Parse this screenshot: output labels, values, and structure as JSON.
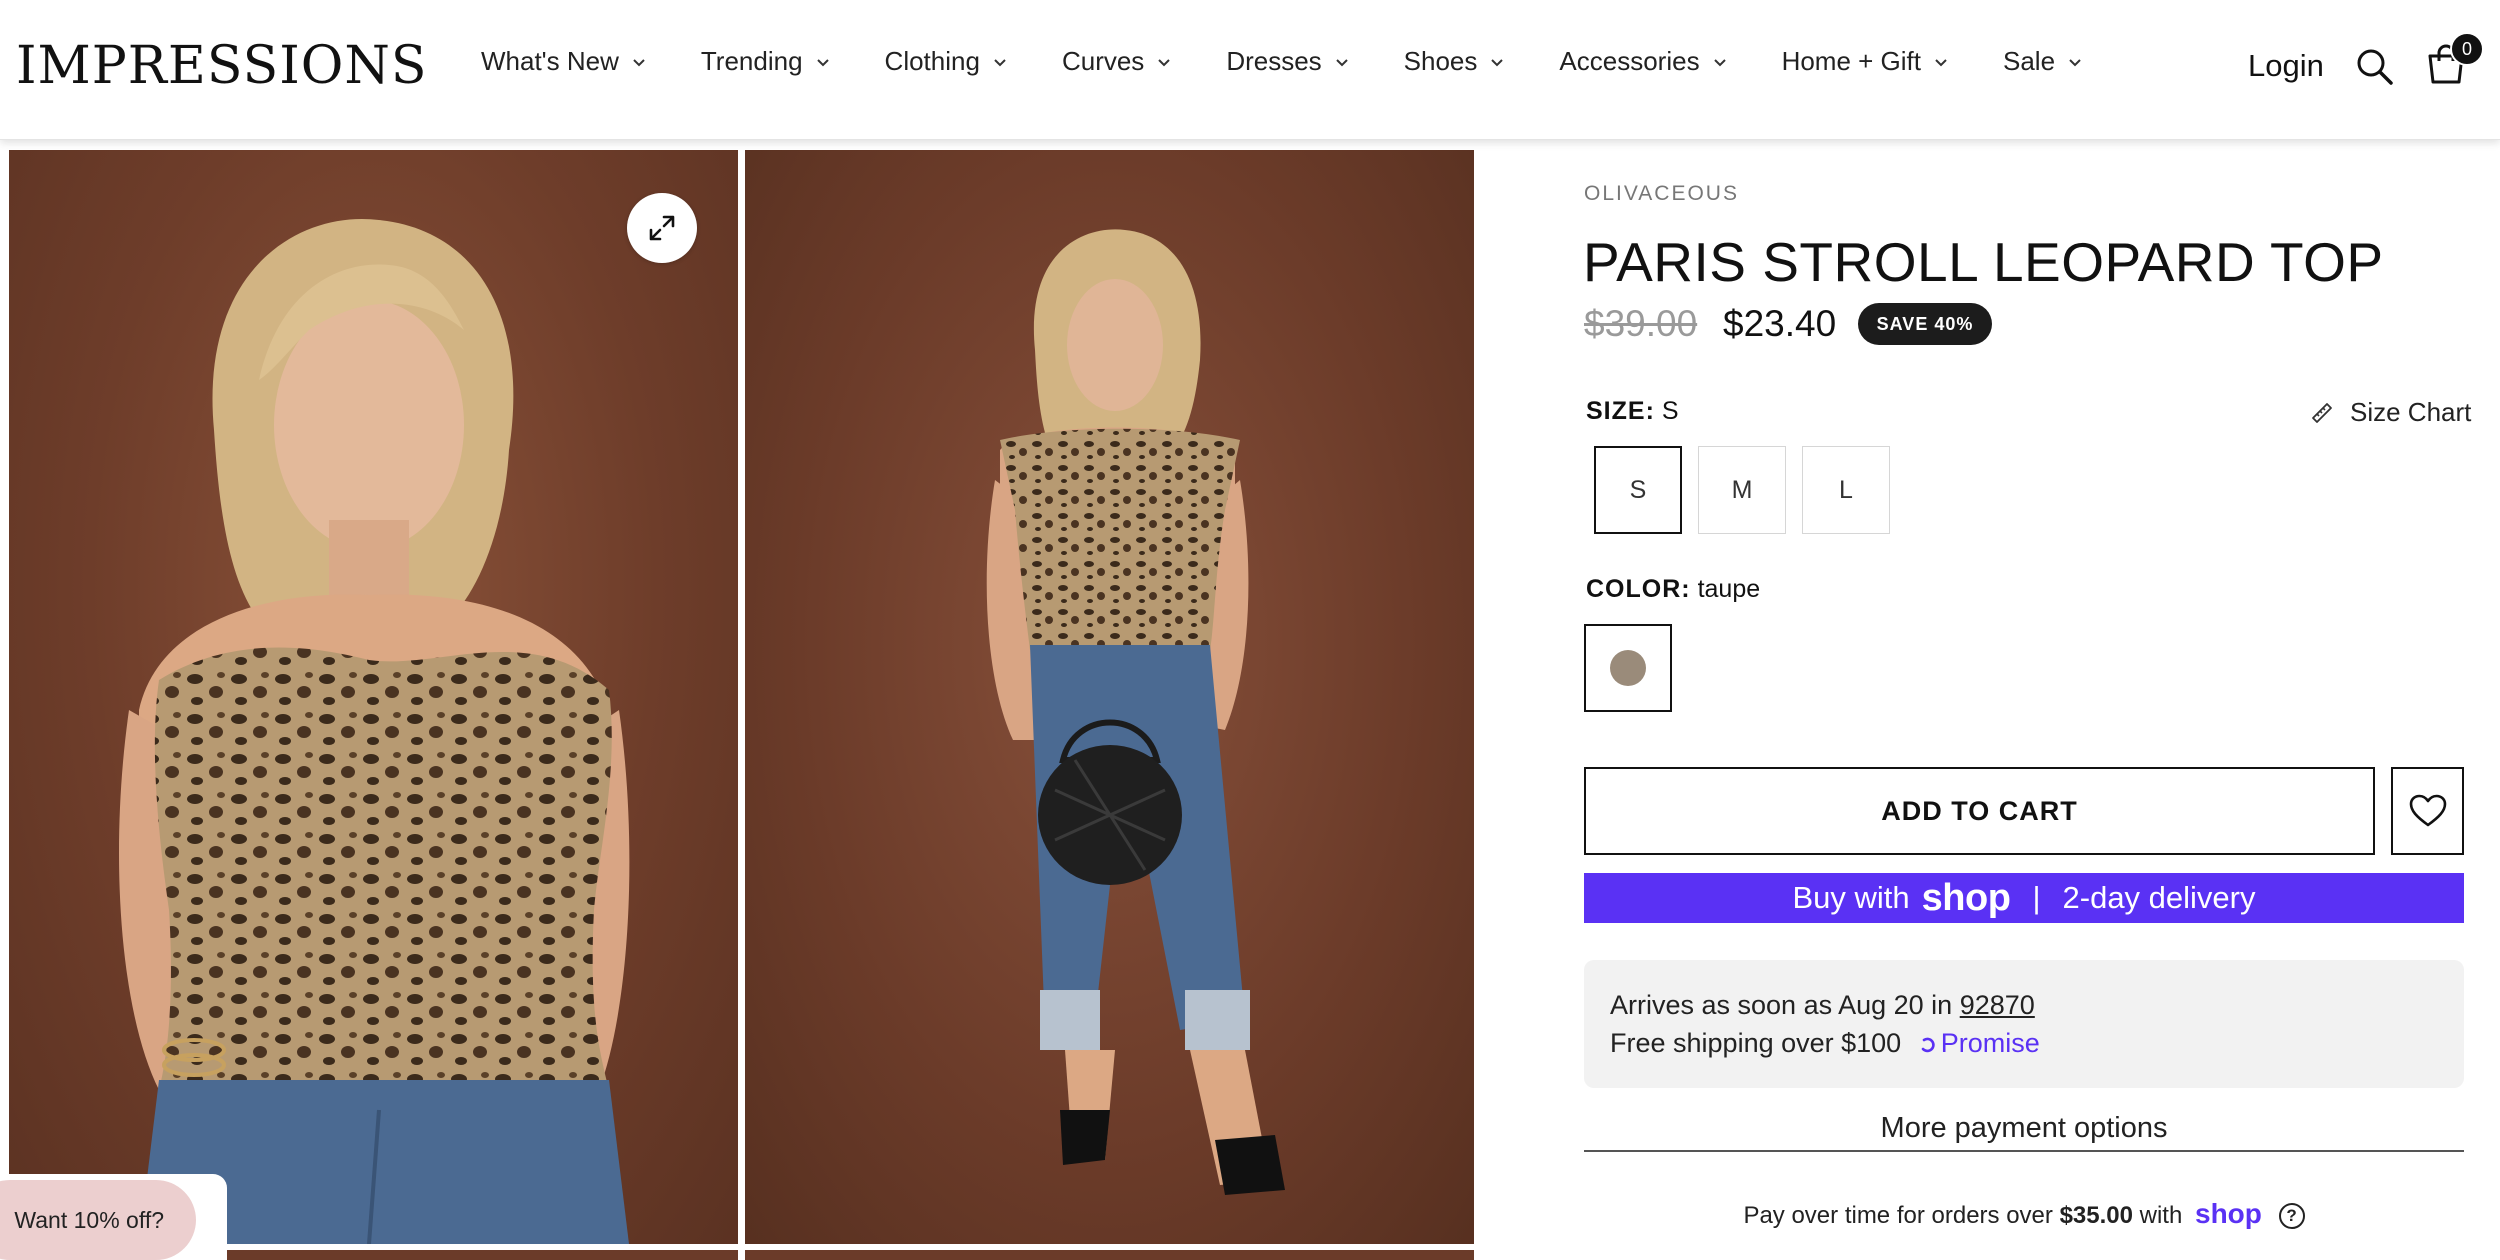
{
  "brand": {
    "logo_text": "IMPRESSIONS"
  },
  "nav": {
    "items": [
      {
        "label": "What's New"
      },
      {
        "label": "Trending"
      },
      {
        "label": "Clothing"
      },
      {
        "label": "Curves"
      },
      {
        "label": "Dresses"
      },
      {
        "label": "Shoes"
      },
      {
        "label": "Accessories"
      },
      {
        "label": "Home + Gift"
      },
      {
        "label": "Sale"
      }
    ],
    "login_label": "Login",
    "cart_count": "0",
    "icons": {
      "search": "search-icon",
      "cart": "shopping-bag-icon",
      "chevron": "chevron-down-icon"
    }
  },
  "gallery": {
    "images": [
      {
        "alt": "Model wearing leopard off-shoulder top, front close view"
      },
      {
        "alt": "Model wearing leopard off-shoulder top, full body view with jeans and black bag"
      }
    ],
    "expand_icon": "expand-icon"
  },
  "product": {
    "vendor": "OLIVACEOUS",
    "title": "PARIS STROLL LEOPARD TOP",
    "price_original": "$39.00",
    "price_sale": "$23.40",
    "save_badge": "SAVE 40%",
    "size": {
      "label": "SIZE:",
      "selected": "S",
      "options": [
        "S",
        "M",
        "L"
      ],
      "size_chart_label": "Size Chart"
    },
    "color": {
      "label": "COLOR:",
      "selected": "taupe",
      "swatch_hex": "#9a8b7a"
    }
  },
  "actions": {
    "add_to_cart": "ADD TO CART",
    "wishlist_icon": "heart-icon",
    "shop_pay": {
      "prefix": "Buy with",
      "brand": "shop",
      "separator": "|",
      "suffix": "2-day delivery"
    },
    "more_payment": "More payment options"
  },
  "delivery": {
    "arrives_prefix": "Arrives as soon as Aug 20 in",
    "zip": "92870",
    "shipping": "Free shipping over $100",
    "promise": "Promise"
  },
  "installments": {
    "prefix": "Pay over time for orders over",
    "amount": "$35.00",
    "with": "with",
    "brand": "shop"
  },
  "promo": {
    "label": "Want 10% off?"
  },
  "colors": {
    "shop_purple": "#5a31f4",
    "photo_backdrop": "#6e3d2a",
    "badge_bg": "#1c1c1c",
    "promo_pink": "#eccfcf"
  }
}
